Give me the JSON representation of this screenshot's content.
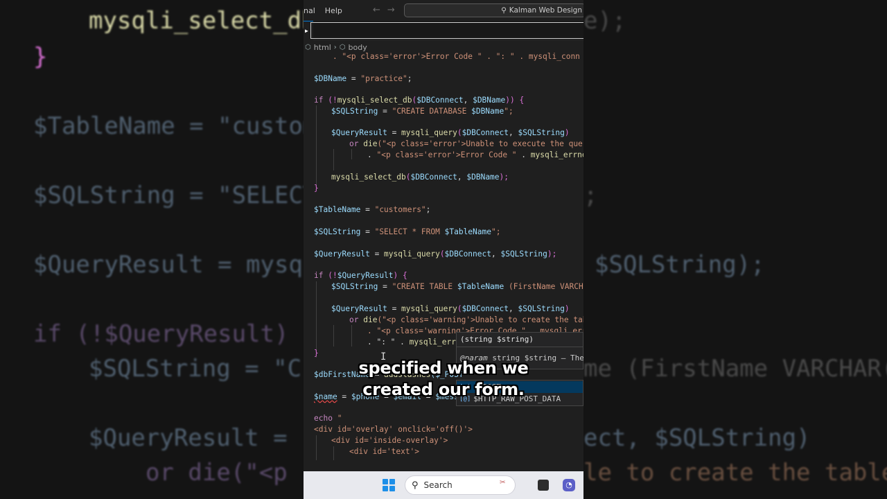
{
  "titlebar": {
    "menu_terminal": "nal",
    "menu_help": "Help",
    "back_arrow": "←",
    "forward_arrow": "→",
    "search_text": "Kalman Web Design"
  },
  "breadcrumb": {
    "item1": "html",
    "item2": "body"
  },
  "code": {
    "l01_a": "    . \"<p class='error'>Error Code \" . \": \" . mysqli_conn",
    "l02_a": "$DBName",
    "l02_b": " = ",
    "l02_c": "\"practice\"",
    "l02_d": ";",
    "l03_a": "if",
    "l03_b": " (!",
    "l03_c": "mysqli_select_db",
    "l03_d": "(",
    "l03_e": "$DBConnect",
    "l03_f": ", ",
    "l03_g": "$DBName",
    "l03_h": ")) {",
    "l04_a": "$SQLString",
    "l04_b": " = ",
    "l04_c": "\"CREATE DATABASE ",
    "l04_d": "$DBName",
    "l04_e": "\";",
    "l05_a": "$QueryResult",
    "l05_b": " = ",
    "l05_c": "mysqli_query",
    "l05_d": "(",
    "l05_e": "$DBConnect",
    "l05_f": ", ",
    "l05_g": "$SQLString",
    "l05_h": ")",
    "l06_a": "or ",
    "l06_b": "die",
    "l06_c": "(\"<p class='error'>Unable to execute the query.",
    "l07_a": ". ",
    "l07_b": "\"<p class='error'>Error Code \"",
    "l07_c": " . ",
    "l07_d": "mysqli_errno",
    "l07_e": "($",
    "l08_a": "mysqli_select_db",
    "l08_b": "(",
    "l08_c": "$DBConnect",
    "l08_d": ", ",
    "l08_e": "$DBName",
    "l08_f": ");",
    "l09_a": "}",
    "l10_a": "$TableName",
    "l10_b": " = ",
    "l10_c": "\"customers\"",
    "l10_d": ";",
    "l11_a": "$SQLString",
    "l11_b": " = ",
    "l11_c": "\"SELECT * FROM ",
    "l11_d": "$TableName",
    "l11_e": "\";",
    "l12_a": "$QueryResult",
    "l12_b": " = ",
    "l12_c": "mysqli_query",
    "l12_d": "(",
    "l12_e": "$DBConnect",
    "l12_f": ", ",
    "l12_g": "$SQLString",
    "l12_h": ");",
    "l13_a": "if",
    "l13_b": " (!",
    "l13_c": "$QueryResult",
    "l13_d": ") {",
    "l14_a": "$SQLString",
    "l14_b": " = ",
    "l14_c": "\"CREATE TABLE ",
    "l14_d": "$TableName",
    "l14_e": " (FirstName VARCHAR(",
    "l15_a": "$QueryResult",
    "l15_b": " = ",
    "l15_c": "mysqli_query",
    "l15_d": "(",
    "l15_e": "$DBConnect",
    "l15_f": ", ",
    "l15_g": "$SQLString",
    "l15_h": ")",
    "l16_a": "or ",
    "l16_b": "die",
    "l16_c": "(\"<p class='warning'>Unable to create the table",
    "l17_a": ". \"<p class='warning'>Error Code \" . mysqli_errno",
    "l18_a": ". \": \" . ",
    "l18_b": "mysqli_erro",
    "l19_a": "}",
    "l20_a": "$dbFirstName",
    "l20_b": " = ",
    "l20_c": "addslashes",
    "l20_d": "($_POST",
    "l21_a": "$name",
    "l21_b": " = ",
    "l21_c": "$phone",
    "l21_d": " = ",
    "l21_e": "$email",
    "l21_f": " = ",
    "l21_g": "$messa",
    "l22_a": "echo",
    "l22_b": " \"",
    "l23_a": "<div id='overlay' onclick='off()'>",
    "l24_a": "<div id='inside-overlay'>",
    "l25_a": "<div id='text'>"
  },
  "hover": {
    "signature": "(string $string)",
    "doc_tag": "@param",
    "doc_text": " string $string — The"
  },
  "suggest": {
    "item1": "$_POST",
    "item2": "$HTTP_RAW_POST_DATA"
  },
  "taskbar": {
    "search_label": "Search"
  },
  "captions": {
    "line1": "specified when we",
    "line2": "created our form."
  },
  "background": {
    "l1": "mysqli_select_db",
    "l1r": "e);",
    "l2": "}",
    "l3": "$TableName = \"custom",
    "l4": "$SQLString = \"SELECT",
    "l4r": ";",
    "l5": "$QueryResult = mysq",
    "l5r": "$SQLString);",
    "l6": "if (!$QueryResult) {",
    "l7": "$SQLString = \"C",
    "l7r": "me (FirstName VARCHAR(",
    "l8": "$QueryResult = ",
    "l8r": "ect, $SQLString)",
    "l9": "or die(\"<p",
    "l9r": "le to create the table"
  }
}
